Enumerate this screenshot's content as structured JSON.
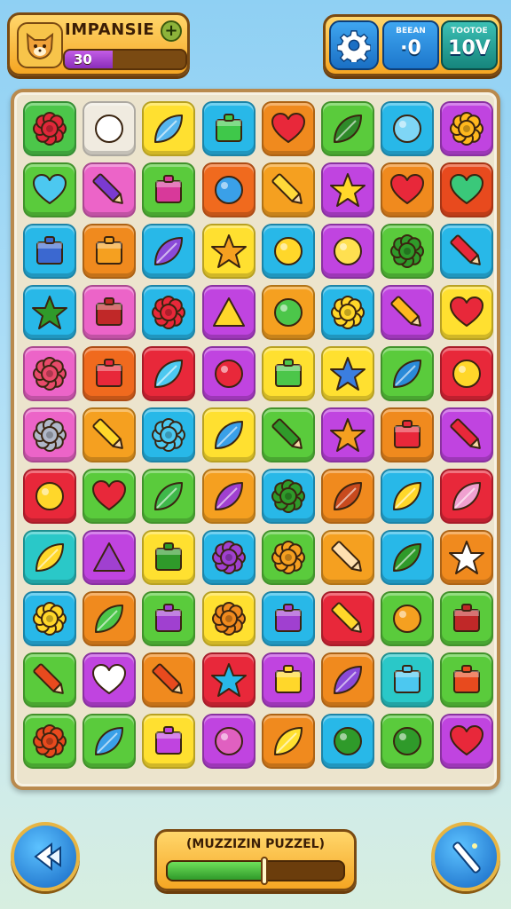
{
  "player": {
    "name": "IMPANSIE",
    "level_text": "30",
    "level_progress": 0.4,
    "add_label": "+"
  },
  "stats": {
    "stat_a": {
      "label": "BEEAN",
      "value": "·0"
    },
    "stat_b": {
      "label": "TOOTOE",
      "value": "10V"
    }
  },
  "puzzle": {
    "title": "(MUZZIZIN PUZZEL)",
    "progress": 0.55
  },
  "board": {
    "rows": 11,
    "cols": 8,
    "tiles": [
      {
        "color": "#4cc64a",
        "icon": "red-gear-icon",
        "shape": "flower",
        "fill": "#e0283a"
      },
      {
        "color": "#f0ebe0",
        "icon": "leaf-outline-icon",
        "shape": "circle",
        "fill": "#ffffff"
      },
      {
        "color": "#ffe030",
        "icon": "blue-leaf-icon",
        "shape": "leaf",
        "fill": "#56b6ee"
      },
      {
        "color": "#28b8e8",
        "icon": "green-box-icon",
        "shape": "box",
        "fill": "#3fc84a"
      },
      {
        "color": "#f08a1e",
        "icon": "heart-icon",
        "shape": "heart",
        "fill": "#e8283a"
      },
      {
        "color": "#5acb3c",
        "icon": "bug-icon",
        "shape": "leaf",
        "fill": "#2f8a2a"
      },
      {
        "color": "#28b8e8",
        "icon": "clock-icon",
        "shape": "circle",
        "fill": "#7fd6f5"
      },
      {
        "color": "#c044e0",
        "icon": "sun-icon",
        "shape": "flower",
        "fill": "#ffb81e"
      },
      {
        "color": "#5acb3c",
        "icon": "heart-icon",
        "shape": "heart",
        "fill": "#4cc8f0"
      },
      {
        "color": "#ec64c8",
        "icon": "pencil-icon",
        "shape": "pencil",
        "fill": "#7a3ad0"
      },
      {
        "color": "#5acb3c",
        "icon": "basket-icon",
        "shape": "box",
        "fill": "#d8399a"
      },
      {
        "color": "#f06a1e",
        "icon": "spoon-icon",
        "shape": "circle",
        "fill": "#3aa0e8"
      },
      {
        "color": "#f5a020",
        "icon": "crayon-icon",
        "shape": "pencil",
        "fill": "#ffd93a"
      },
      {
        "color": "#c044e0",
        "icon": "star-icon",
        "shape": "star",
        "fill": "#ffd72a"
      },
      {
        "color": "#f08a1e",
        "icon": "heart-icon",
        "shape": "heart",
        "fill": "#e8283a"
      },
      {
        "color": "#e84a1e",
        "icon": "heart-icon",
        "shape": "heart",
        "fill": "#3ac87a"
      },
      {
        "color": "#28b8e8",
        "icon": "basket-icon",
        "shape": "box",
        "fill": "#3b68d0"
      },
      {
        "color": "#f08a1e",
        "icon": "frame-icon",
        "shape": "box",
        "fill": "#f5a020"
      },
      {
        "color": "#28b8e8",
        "icon": "leaf-icon",
        "shape": "leaf",
        "fill": "#8a4ad8"
      },
      {
        "color": "#ffe030",
        "icon": "tree-icon",
        "shape": "star",
        "fill": "#f5a020"
      },
      {
        "color": "#28b8e8",
        "icon": "smile-icon",
        "shape": "circle",
        "fill": "#ffd72a"
      },
      {
        "color": "#c044e0",
        "icon": "smile-icon",
        "shape": "circle",
        "fill": "#ffe050"
      },
      {
        "color": "#5acb3c",
        "icon": "leaf-icon",
        "shape": "flower",
        "fill": "#2f9a2a"
      },
      {
        "color": "#28b8e8",
        "icon": "pencil-icon",
        "shape": "pencil",
        "fill": "#e8283a"
      },
      {
        "color": "#28b8e8",
        "icon": "star-icon",
        "shape": "star",
        "fill": "#2f9a2a"
      },
      {
        "color": "#ec64c8",
        "icon": "box-icon",
        "shape": "box",
        "fill": "#c02828"
      },
      {
        "color": "#28b8e8",
        "icon": "gear-icon",
        "shape": "flower",
        "fill": "#e8283a"
      },
      {
        "color": "#c044e0",
        "icon": "triangle-icon",
        "shape": "triangle",
        "fill": "#ffd72a"
      },
      {
        "color": "#f5a020",
        "icon": "hook-icon",
        "shape": "circle",
        "fill": "#4cc64a"
      },
      {
        "color": "#28b8e8",
        "icon": "flower-icon",
        "shape": "flower",
        "fill": "#ffd72a"
      },
      {
        "color": "#c044e0",
        "icon": "bone-icon",
        "shape": "pencil",
        "fill": "#ffb81e"
      },
      {
        "color": "#ffe030",
        "icon": "heart-icon",
        "shape": "heart",
        "fill": "#e8283a"
      },
      {
        "color": "#ec64c8",
        "icon": "gear-icon",
        "shape": "flower",
        "fill": "#e84a6a"
      },
      {
        "color": "#f06a1e",
        "icon": "jar-icon",
        "shape": "box",
        "fill": "#e8283a"
      },
      {
        "color": "#e8283a",
        "icon": "leaf-icon",
        "shape": "leaf",
        "fill": "#4cc8f0"
      },
      {
        "color": "#c044e0",
        "icon": "target-icon",
        "shape": "circle",
        "fill": "#e8283a"
      },
      {
        "color": "#ffe030",
        "icon": "bottle-icon",
        "shape": "box",
        "fill": "#4cc64a"
      },
      {
        "color": "#ffe030",
        "icon": "signpost-icon",
        "shape": "star",
        "fill": "#3b7ee0"
      },
      {
        "color": "#5acb3c",
        "icon": "drop-icon",
        "shape": "leaf",
        "fill": "#2a8ad8"
      },
      {
        "color": "#e8283a",
        "icon": "duck-icon",
        "shape": "circle",
        "fill": "#ffd72a"
      },
      {
        "color": "#ec64c8",
        "icon": "gear-icon",
        "shape": "flower",
        "fill": "#b0b8c8"
      },
      {
        "color": "#f5a020",
        "icon": "pencil-icon",
        "shape": "pencil",
        "fill": "#ffd72a"
      },
      {
        "color": "#28b8e8",
        "icon": "splash-icon",
        "shape": "flower",
        "fill": "#4cc8f0"
      },
      {
        "color": "#ffe030",
        "icon": "leaf-icon",
        "shape": "leaf",
        "fill": "#3aa0e8"
      },
      {
        "color": "#5acb3c",
        "icon": "marker-icon",
        "shape": "pencil",
        "fill": "#2f9a2a"
      },
      {
        "color": "#c044e0",
        "icon": "maple-leaf-icon",
        "shape": "star",
        "fill": "#f5a020"
      },
      {
        "color": "#f08a1e",
        "icon": "pot-icon",
        "shape": "box",
        "fill": "#e8283a"
      },
      {
        "color": "#c044e0",
        "icon": "brush-icon",
        "shape": "pencil",
        "fill": "#e8283a"
      },
      {
        "color": "#e8283a",
        "icon": "swirl-icon",
        "shape": "circle",
        "fill": "#ffd72a"
      },
      {
        "color": "#5acb3c",
        "icon": "heart-icon",
        "shape": "heart",
        "fill": "#e8283a"
      },
      {
        "color": "#5acb3c",
        "icon": "leaf-icon",
        "shape": "leaf",
        "fill": "#3fb84a"
      },
      {
        "color": "#f5a020",
        "icon": "leaf-icon",
        "shape": "leaf",
        "fill": "#a040d0"
      },
      {
        "color": "#28b8e8",
        "icon": "gear-icon",
        "shape": "flower",
        "fill": "#2f9a2a"
      },
      {
        "color": "#f08a1e",
        "icon": "fern-icon",
        "shape": "leaf",
        "fill": "#c84a1e"
      },
      {
        "color": "#28b8e8",
        "icon": "leaf-icon",
        "shape": "leaf",
        "fill": "#ffd72a"
      },
      {
        "color": "#e8283a",
        "icon": "petal-icon",
        "shape": "leaf",
        "fill": "#f0a0d0"
      },
      {
        "color": "#2ac8c8",
        "icon": "leaf-icon",
        "shape": "leaf",
        "fill": "#ffd72a"
      },
      {
        "color": "#c044e0",
        "icon": "bell-icon",
        "shape": "triangle",
        "fill": "#a040d0"
      },
      {
        "color": "#ffe030",
        "icon": "gem-icon",
        "shape": "box",
        "fill": "#2f9a2a"
      },
      {
        "color": "#28b8e8",
        "icon": "flower-icon",
        "shape": "flower",
        "fill": "#a040d0"
      },
      {
        "color": "#5acb3c",
        "icon": "gear-icon",
        "shape": "flower",
        "fill": "#f5a020"
      },
      {
        "color": "#f5a020",
        "icon": "bandage-icon",
        "shape": "pencil",
        "fill": "#ffe0b0"
      },
      {
        "color": "#28b8e8",
        "icon": "fern-icon",
        "shape": "leaf",
        "fill": "#2f9a2a"
      },
      {
        "color": "#f08a1e",
        "icon": "cat-icon",
        "shape": "star",
        "fill": "#ffffff"
      },
      {
        "color": "#28b8e8",
        "icon": "gear-icon",
        "shape": "flower",
        "fill": "#ffd72a"
      },
      {
        "color": "#f08a1e",
        "icon": "leaf-icon",
        "shape": "leaf",
        "fill": "#4cc64a"
      },
      {
        "color": "#5acb3c",
        "icon": "basket-icon",
        "shape": "box",
        "fill": "#a040d0"
      },
      {
        "color": "#ffe030",
        "icon": "gear-icon",
        "shape": "flower",
        "fill": "#f08a1e"
      },
      {
        "color": "#28b8e8",
        "icon": "pouch-icon",
        "shape": "box",
        "fill": "#a040d0"
      },
      {
        "color": "#e8283a",
        "icon": "roller-icon",
        "shape": "pencil",
        "fill": "#ffd72a"
      },
      {
        "color": "#5acb3c",
        "icon": "berry-icon",
        "shape": "circle",
        "fill": "#f5a020"
      },
      {
        "color": "#5acb3c",
        "icon": "books-icon",
        "shape": "box",
        "fill": "#c02828"
      },
      {
        "color": "#5acb3c",
        "icon": "crayon-icon",
        "shape": "pencil",
        "fill": "#e84a1e"
      },
      {
        "color": "#c044e0",
        "icon": "heart-outline-icon",
        "shape": "heart",
        "fill": "#ffffff"
      },
      {
        "color": "#f08a1e",
        "icon": "marker-icon",
        "shape": "pencil",
        "fill": "#e84a1e"
      },
      {
        "color": "#e8283a",
        "icon": "star-icon",
        "shape": "star",
        "fill": "#28b8e8"
      },
      {
        "color": "#c044e0",
        "icon": "stripes-icon",
        "shape": "box",
        "fill": "#ffd72a"
      },
      {
        "color": "#f08a1e",
        "icon": "feather-icon",
        "shape": "leaf",
        "fill": "#8a4ad8"
      },
      {
        "color": "#2ac8c8",
        "icon": "screen-icon",
        "shape": "box",
        "fill": "#4cc8f0"
      },
      {
        "color": "#5acb3c",
        "icon": "cube-icon",
        "shape": "box",
        "fill": "#e84a1e"
      },
      {
        "color": "#5acb3c",
        "icon": "leaf-icon",
        "shape": "flower",
        "fill": "#e84a1e"
      },
      {
        "color": "#5acb3c",
        "icon": "drop-icon",
        "shape": "leaf",
        "fill": "#3aa0e8"
      },
      {
        "color": "#ffe030",
        "icon": "bottle-icon",
        "shape": "box",
        "fill": "#c044e0"
      },
      {
        "color": "#c044e0",
        "icon": "plum-icon",
        "shape": "circle",
        "fill": "#e060c0"
      },
      {
        "color": "#f08a1e",
        "icon": "leaf-icon",
        "shape": "leaf",
        "fill": "#ffe030"
      },
      {
        "color": "#28b8e8",
        "icon": "wreath-icon",
        "shape": "circle",
        "fill": "#2f9a2a"
      },
      {
        "color": "#5acb3c",
        "icon": "ball-icon",
        "shape": "circle",
        "fill": "#2f9a2a"
      },
      {
        "color": "#c044e0",
        "icon": "heart-icon",
        "shape": "heart",
        "fill": "#e8283a"
      }
    ]
  },
  "buttons": {
    "back": "back-icon",
    "hint": "wand-icon",
    "settings": "gear-icon"
  }
}
